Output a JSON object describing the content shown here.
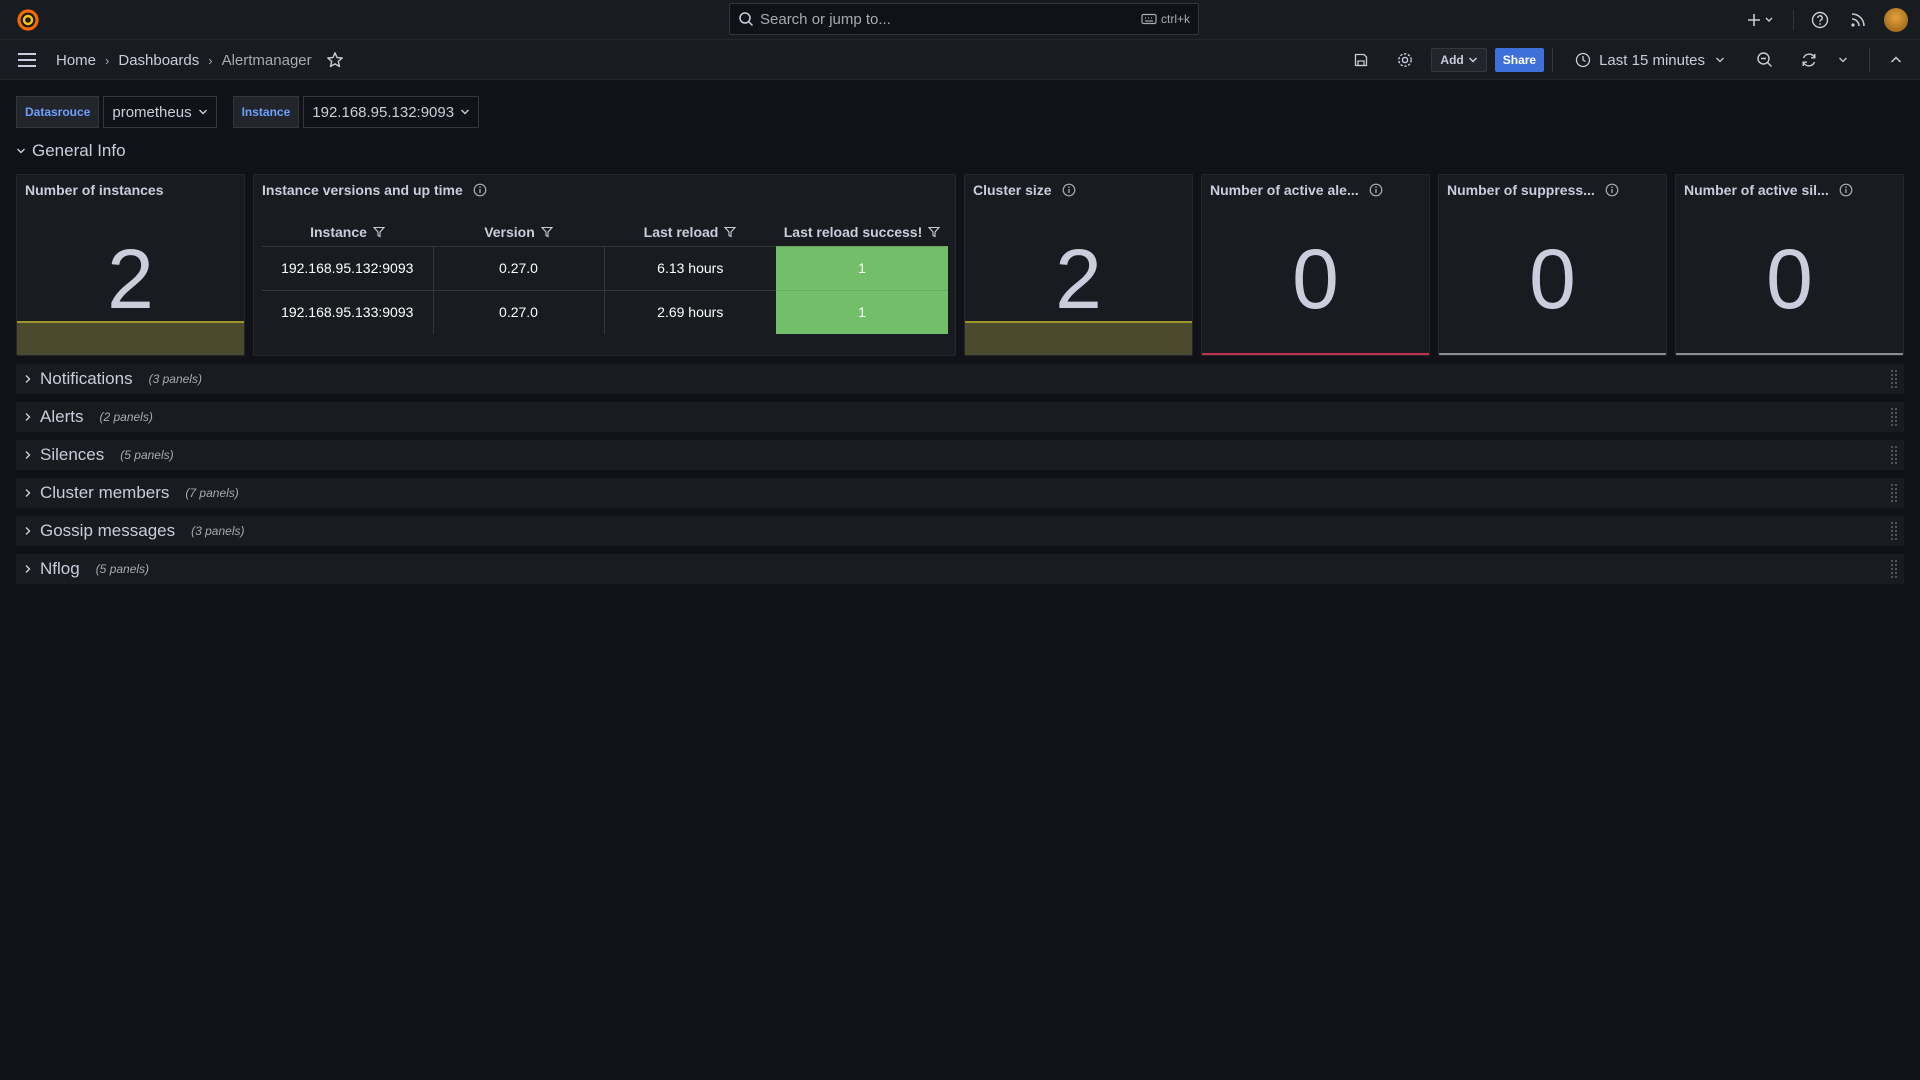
{
  "search": {
    "placeholder": "Search or jump to...",
    "shortcut": "ctrl+k"
  },
  "breadcrumb": {
    "home": "Home",
    "dashboards": "Dashboards",
    "current": "Alertmanager"
  },
  "toolbar": {
    "add_label": "Add",
    "share_label": "Share",
    "time_range": "Last 15 minutes"
  },
  "variables": [
    {
      "label": "Datasrouce",
      "value": "prometheus"
    },
    {
      "label": "Instance",
      "value": "192.168.95.132:9093"
    }
  ],
  "general_row": {
    "title": "General Info"
  },
  "panels": {
    "instances": {
      "title": "Number of instances",
      "value": "2"
    },
    "versions": {
      "title": "Instance versions and up time",
      "columns": [
        "Instance",
        "Version",
        "Last reload",
        "Last reload success!"
      ],
      "rows": [
        [
          "192.168.95.132:9093",
          "0.27.0",
          "6.13 hours",
          "1"
        ],
        [
          "192.168.95.133:9093",
          "0.27.0",
          "2.69 hours",
          "1"
        ]
      ]
    },
    "cluster": {
      "title": "Cluster size",
      "value": "2"
    },
    "active_alerts": {
      "title": "Number of active ale...",
      "value": "0"
    },
    "suppressed": {
      "title": "Number of suppress...",
      "value": "0"
    },
    "silences": {
      "title": "Number of active sil...",
      "value": "0"
    }
  },
  "collapsed_rows": [
    {
      "title": "Notifications",
      "count": "(3 panels)"
    },
    {
      "title": "Alerts",
      "count": "(2 panels)"
    },
    {
      "title": "Silences",
      "count": "(5 panels)"
    },
    {
      "title": "Cluster members",
      "count": "(7 panels)"
    },
    {
      "title": "Gossip messages",
      "count": "(3 panels)"
    },
    {
      "title": "Nflog",
      "count": "(5 panels)"
    }
  ],
  "colors": {
    "background": "#111217",
    "panel": "#181b1f",
    "accent_blue": "#3d71d9",
    "success_green": "#73bf69",
    "sparkline_yellow": "#a0952a",
    "alert_red": "#c4314b"
  },
  "icons": [
    "grafana-logo-icon",
    "search-icon",
    "keyboard-icon",
    "plus-icon",
    "help-icon",
    "rss-icon",
    "menu-icon",
    "star-icon",
    "save-icon",
    "gear-icon",
    "clock-icon",
    "zoom-out-icon",
    "refresh-icon",
    "chevron-up-icon",
    "info-icon",
    "filter-icon",
    "drag-handle-icon"
  ]
}
